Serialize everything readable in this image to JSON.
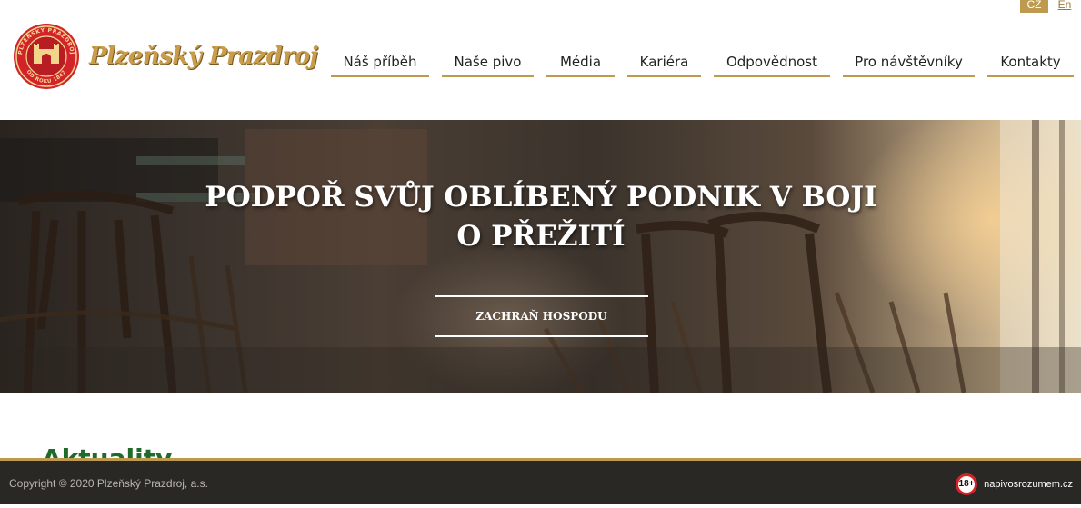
{
  "lang": {
    "cz": "CZ",
    "en": "En"
  },
  "logo": {
    "name": "Plzeňský Prazdroj",
    "seal_top": "PLZEŇSKÝ PRAZDROJ",
    "seal_bottom": "OD ROKU 1842"
  },
  "nav": {
    "items": [
      {
        "label": "Náš příběh"
      },
      {
        "label": "Naše pivo"
      },
      {
        "label": "Média"
      },
      {
        "label": "Kariéra"
      },
      {
        "label": "Odpovědnost"
      },
      {
        "label": "Pro návštěvníky"
      },
      {
        "label": "Kontakty"
      }
    ]
  },
  "hero": {
    "title": "PODPOŘ SVŮJ OBLÍBENÝ PODNIK V BOJI O PŘEŽITÍ",
    "cta": "ZACHRAŇ HOSPODU"
  },
  "news": {
    "heading": "Aktuality"
  },
  "footer": {
    "copyright": "Copyright © 2020 Plzeňský Prazdroj, a.s.",
    "age_badge": "18+",
    "age_link": "napivosrozumem.cz"
  },
  "colors": {
    "accent_gold": "#bd9a4e",
    "footer_bg": "#2a2825",
    "heading_green": "#1f6b2a",
    "badge_red": "#d2232a"
  }
}
